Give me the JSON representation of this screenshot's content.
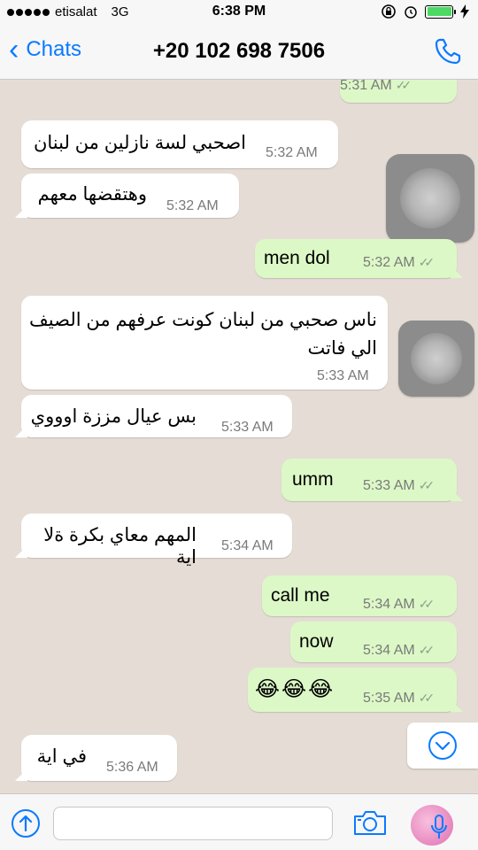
{
  "status_bar": {
    "carrier": "etisalat",
    "network": "3G",
    "time": "6:38 PM"
  },
  "nav": {
    "back_label": "Chats",
    "title": "+20 102 698 7506"
  },
  "messages": [
    {
      "dir": "out",
      "text": "",
      "time": "5:31 AM",
      "ticks": "✓✓"
    },
    {
      "dir": "in",
      "text": "اصحبي لسة نازلين من لبنان",
      "time": "5:32 AM"
    },
    {
      "dir": "in",
      "text": "وهتقضها معهم",
      "time": "5:32 AM"
    },
    {
      "dir": "out",
      "text": "men dol",
      "time": "5:32 AM",
      "ticks": "✓✓"
    },
    {
      "dir": "in",
      "text": "ناس صحبي من لبنان كونت عرفهم من الصيف الي فاتت",
      "time": "5:33 AM"
    },
    {
      "dir": "in",
      "text": "بس عيال مززة اوووي",
      "time": "5:33 AM"
    },
    {
      "dir": "out",
      "text": "umm",
      "time": "5:33 AM",
      "ticks": "✓✓"
    },
    {
      "dir": "in",
      "text": "المهم معاي بكرة ةلا اية",
      "time": "5:34 AM"
    },
    {
      "dir": "out",
      "text": "call me",
      "time": "5:34 AM",
      "ticks": "✓✓"
    },
    {
      "dir": "out",
      "text": "now",
      "time": "5:34 AM",
      "ticks": "✓✓"
    },
    {
      "dir": "out",
      "text": "😂😂😂",
      "time": "5:35 AM",
      "ticks": "✓✓"
    },
    {
      "dir": "in",
      "text": "في اية",
      "time": "5:36 AM"
    }
  ],
  "input": {
    "value": "",
    "placeholder": ""
  },
  "colors": {
    "accent": "#0a7aff",
    "outgoing_bubble": "#dcf8c6",
    "incoming_bubble": "#ffffff",
    "chat_background": "#e5ddd5"
  },
  "icons": [
    "back-chevron-icon",
    "phone-icon",
    "share-arrow-icon",
    "camera-icon",
    "microphone-icon",
    "chevron-down-icon",
    "orientation-lock-icon",
    "alarm-icon",
    "battery-icon",
    "charging-icon"
  ]
}
